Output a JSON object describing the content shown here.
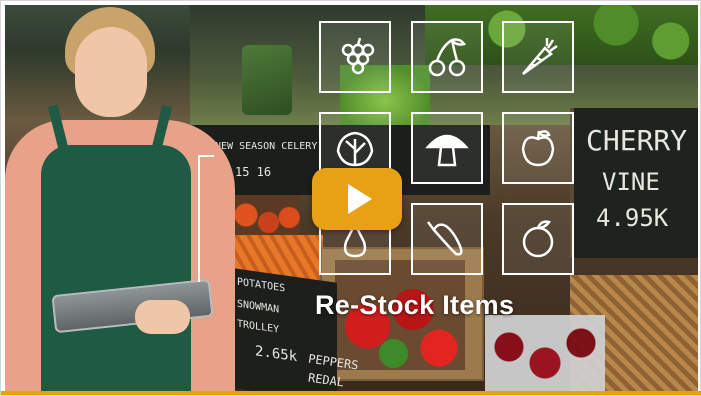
{
  "video": {
    "title": "Re-Stock Items",
    "play_label": "Play video",
    "accent_color": "#e8a113"
  },
  "overlay_icons": [
    {
      "name": "grapes-icon"
    },
    {
      "name": "cherries-icon"
    },
    {
      "name": "carrot-icon"
    },
    {
      "name": "lettuce-icon"
    },
    {
      "name": "mushroom-icon"
    },
    {
      "name": "apple-icon"
    },
    {
      "name": "pear-icon"
    },
    {
      "name": "pepper-icon"
    },
    {
      "name": "orange-icon"
    }
  ],
  "scene_signs": {
    "chalkboard_right": [
      "CHERRY",
      "VINE",
      "4.95K"
    ],
    "chalkboard_left": [
      "POTATOES",
      "SNOWMAN",
      "TROLLEY",
      "2.65k"
    ],
    "chalkboard_bottom": [
      "PEPPERS",
      "REDAL"
    ],
    "sign_strip": "NEW SEASON CELERY",
    "sign_numbers": "15 16"
  }
}
